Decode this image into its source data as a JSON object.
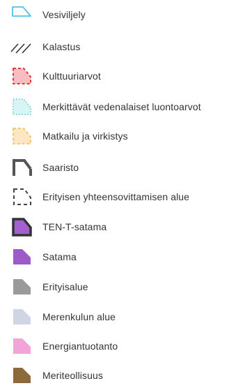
{
  "legend": {
    "items": [
      {
        "label": "Vesiviljely",
        "icon": "vesiviljely-icon",
        "fill": "none",
        "stroke": "#4fc3e8",
        "style": "solid-outline"
      },
      {
        "label": "Kalastus",
        "icon": "kalastus-hatch-icon",
        "fill": "none",
        "stroke": "#333333",
        "style": "hatch-lines"
      },
      {
        "label": "Kulttuuriarvot",
        "icon": "kulttuuriarvot-icon",
        "fill": "#f7bdc3",
        "stroke": "#e53935",
        "style": "dashed"
      },
      {
        "label": "Merkittävät vedenalaiset luontoarvot",
        "icon": "luontoarvot-icon",
        "fill": "#d7f5f4",
        "stroke": "#5cc6c0",
        "style": "dotted"
      },
      {
        "label": "Matkailu ja virkistys",
        "icon": "matkailu-icon",
        "fill": "#fde7c2",
        "stroke": "#f5c35c",
        "style": "dashed"
      },
      {
        "label": "Saaristo",
        "icon": "saaristo-icon",
        "fill": "none",
        "stroke": "#555555",
        "style": "thick-outline-partial"
      },
      {
        "label": "Erityisen yhteensovittamisen alue",
        "icon": "yhteensovittaminen-icon",
        "fill": "none",
        "stroke": "#444444",
        "style": "dashed"
      },
      {
        "label": "TEN-T-satama",
        "icon": "tent-satama-icon",
        "fill": "#a45fd0",
        "stroke": "#333333",
        "style": "filled-thick-outline"
      },
      {
        "label": "Satama",
        "icon": "satama-icon",
        "fill": "#9c5bc6",
        "stroke": "none",
        "style": "filled"
      },
      {
        "label": "Erityisalue",
        "icon": "erityisalue-icon",
        "fill": "#9a9a9a",
        "stroke": "none",
        "style": "filled"
      },
      {
        "label": "Merenkulun alue",
        "icon": "merenkulku-icon",
        "fill": "#cfd5e3",
        "stroke": "none",
        "style": "filled"
      },
      {
        "label": "Energiantuotanto",
        "icon": "energiantuotanto-icon",
        "fill": "#f2a4d8",
        "stroke": "none",
        "style": "filled"
      },
      {
        "label": "Meriteollisuus",
        "icon": "meriteollisuus-icon",
        "fill": "#8c6a3c",
        "stroke": "none",
        "style": "filled"
      }
    ]
  }
}
